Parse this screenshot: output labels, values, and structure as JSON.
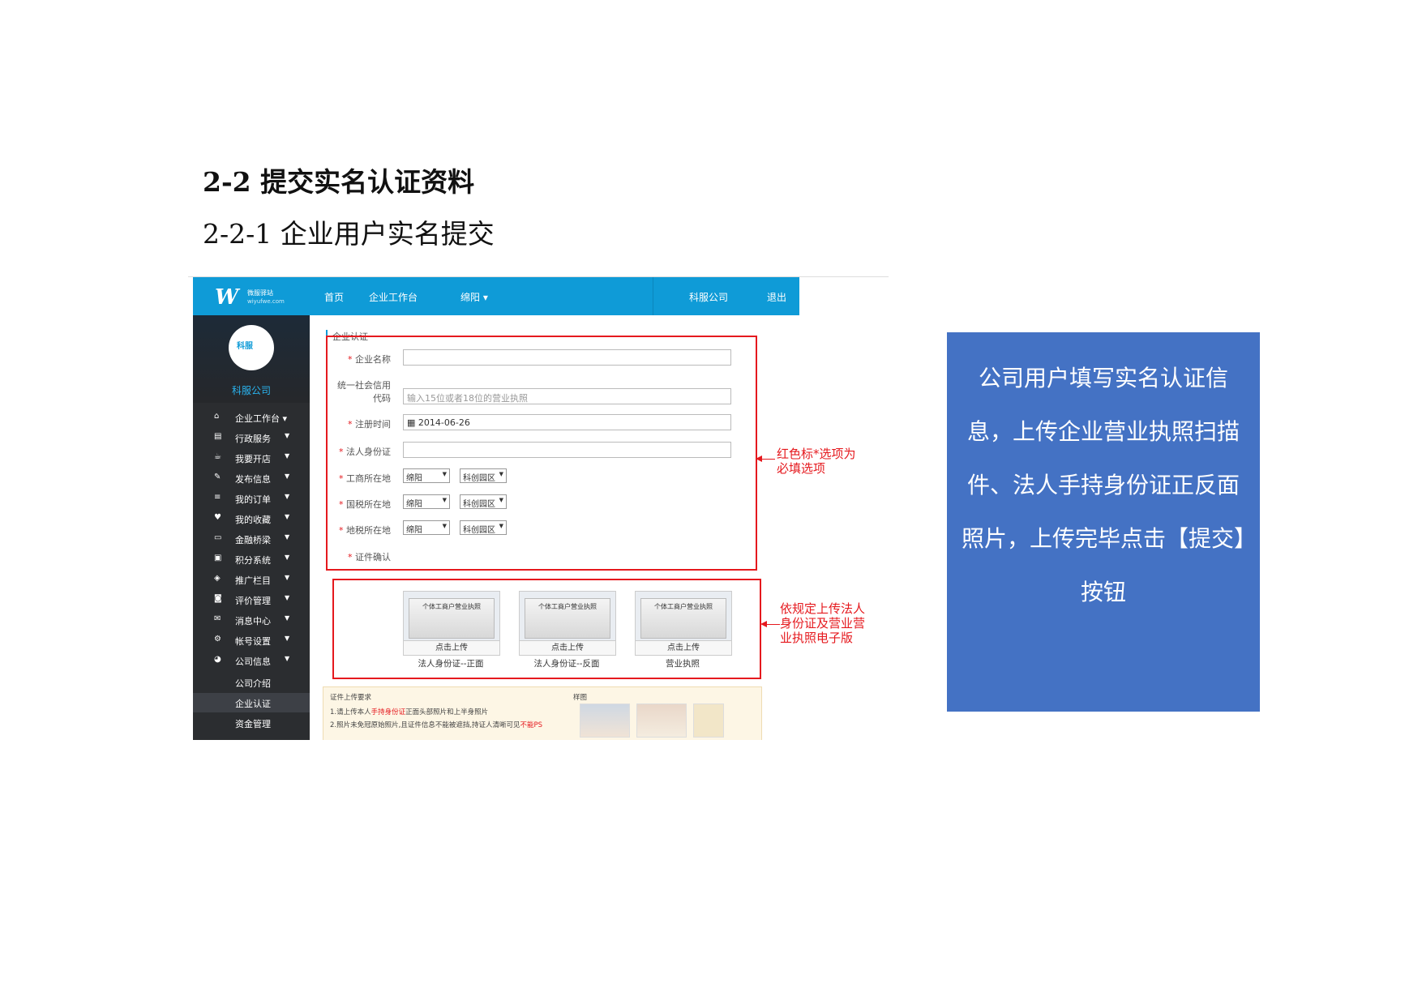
{
  "heading": {
    "section": "2-2 提交实名认证资料",
    "subsection": "2-2-1 企业用户实名提交"
  },
  "topbar": {
    "logo_mark": "W",
    "logo_cn": "微服驿站",
    "logo_url": "wiyufwe.com",
    "nav": [
      "首页",
      "企业工作台",
      "绵阳 ▾",
      "科服公司",
      "退出"
    ]
  },
  "sidebar": {
    "avatar_text": "科服",
    "company": "科服公司",
    "items": [
      {
        "label": "企业工作台 ▾",
        "icon": "home-icon",
        "glyph": "⌂"
      },
      {
        "label": "行政服务",
        "icon": "document-icon",
        "glyph": "▤"
      },
      {
        "label": "我要开店",
        "icon": "cup-icon",
        "glyph": "☕"
      },
      {
        "label": "发布信息",
        "icon": "pencil-icon",
        "glyph": "✎"
      },
      {
        "label": "我的订单",
        "icon": "list-icon",
        "glyph": "≡"
      },
      {
        "label": "我的收藏",
        "icon": "heart-icon",
        "glyph": "♥"
      },
      {
        "label": "金融桥梁",
        "icon": "card-icon",
        "glyph": "▭"
      },
      {
        "label": "积分系统",
        "icon": "gift-icon",
        "glyph": "▣"
      },
      {
        "label": "推广栏目",
        "icon": "cube-icon",
        "glyph": "◈"
      },
      {
        "label": "评价管理",
        "icon": "comment-icon",
        "glyph": "◙"
      },
      {
        "label": "消息中心",
        "icon": "envelope-icon",
        "glyph": "✉"
      },
      {
        "label": "帐号设置",
        "icon": "gear-icon",
        "glyph": "⚙"
      },
      {
        "label": "公司信息",
        "icon": "pie-icon",
        "glyph": "◕"
      }
    ],
    "subitems": [
      "公司介绍",
      "企业认证",
      "资金管理"
    ],
    "active_subitem": "企业认证"
  },
  "form": {
    "section_title": "企业认证",
    "company_name_label": "企业名称",
    "credit_code_label_1": "统一社会信用",
    "credit_code_label_2": "代码",
    "credit_code_placeholder": "输入15位或者18位的营业执照",
    "reg_date_label": "注册时间",
    "reg_date_value": "2014-06-26",
    "legal_id_label": "法人身份证",
    "business_location_label": "工商所在地",
    "national_tax_label": "国税所在地",
    "local_tax_label": "地税所在地",
    "city_value": "绵阳",
    "district_value": "科创园区",
    "certificate_label": "证件确认",
    "doc_title": "个体工商户营业执照",
    "upload_button": "点击上传",
    "upload_captions": [
      "法人身份证--正面",
      "法人身份证--反面",
      "营业执照"
    ],
    "requirements_title": "证件上传要求",
    "req_line1_a": "1.请上传本人",
    "req_line1_b": "手持身份证",
    "req_line1_c": "正面头部照片和上半身照片",
    "req_line2_a": "2.照片未免冠原始照片,且证件信息不能被遮挡,持证人清晰可见",
    "req_line2_b": "不能PS",
    "example_title": "样图"
  },
  "annotations": {
    "required_note_1": "红色标*选项为",
    "required_note_2": "必填选项",
    "upload_note_1": "依规定上传法人",
    "upload_note_2": "身份证及营业营",
    "upload_note_3": "业执照电子版"
  },
  "callout": {
    "text": "公司用户填写实名认证信息，上传企业营业执照扫描件、法人手持身份证正反面照片，上传完毕点击【提交】按钮",
    "background": "#4472c4"
  },
  "colors": {
    "topbar": "#0f9bd7",
    "sidebar": "#2b2d30",
    "annotation_red": "#e5191e"
  }
}
